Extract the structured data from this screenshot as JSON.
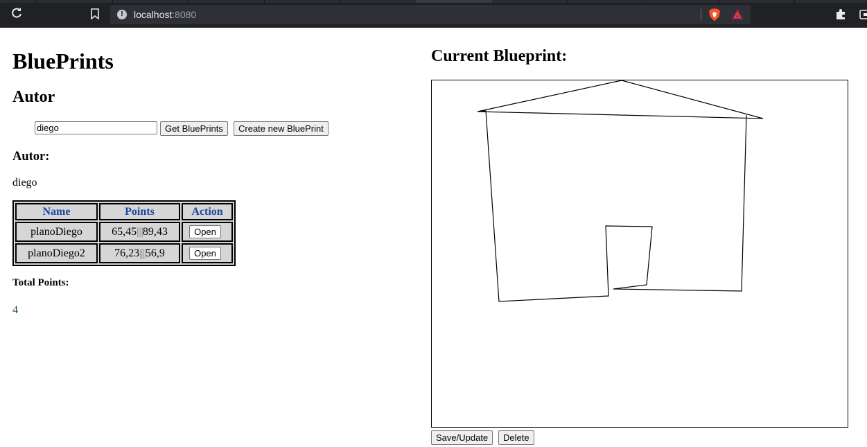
{
  "browser": {
    "url_host": "localhost",
    "url_port": ":8080"
  },
  "page": {
    "title": "BluePrints",
    "autor_heading": "Autor",
    "author_input_value": "diego",
    "get_button": "Get BluePrints",
    "create_button": "Create new BluePrint",
    "autor_label": "Autor:",
    "author_name": "diego",
    "table": {
      "headers": [
        "Name",
        "Points",
        "Action"
      ],
      "rows": [
        {
          "name": "planoDiego",
          "points_a": "65,45",
          "sep": "||||",
          "points_b": "89,43",
          "action": "Open"
        },
        {
          "name": "planoDiego2",
          "points_a": "76,23",
          "sep": "||||",
          "points_b": "56,9",
          "action": "Open"
        }
      ]
    },
    "total_label": "Total Points:",
    "total_value": "4",
    "current_heading": "Current Blueprint:",
    "save_button": "Save/Update",
    "delete_button": "Delete"
  },
  "colors": {
    "table_header_text": "#1c47a0",
    "table_bg": "#d6d6d6",
    "total_value_text": "#1a5c2a"
  }
}
